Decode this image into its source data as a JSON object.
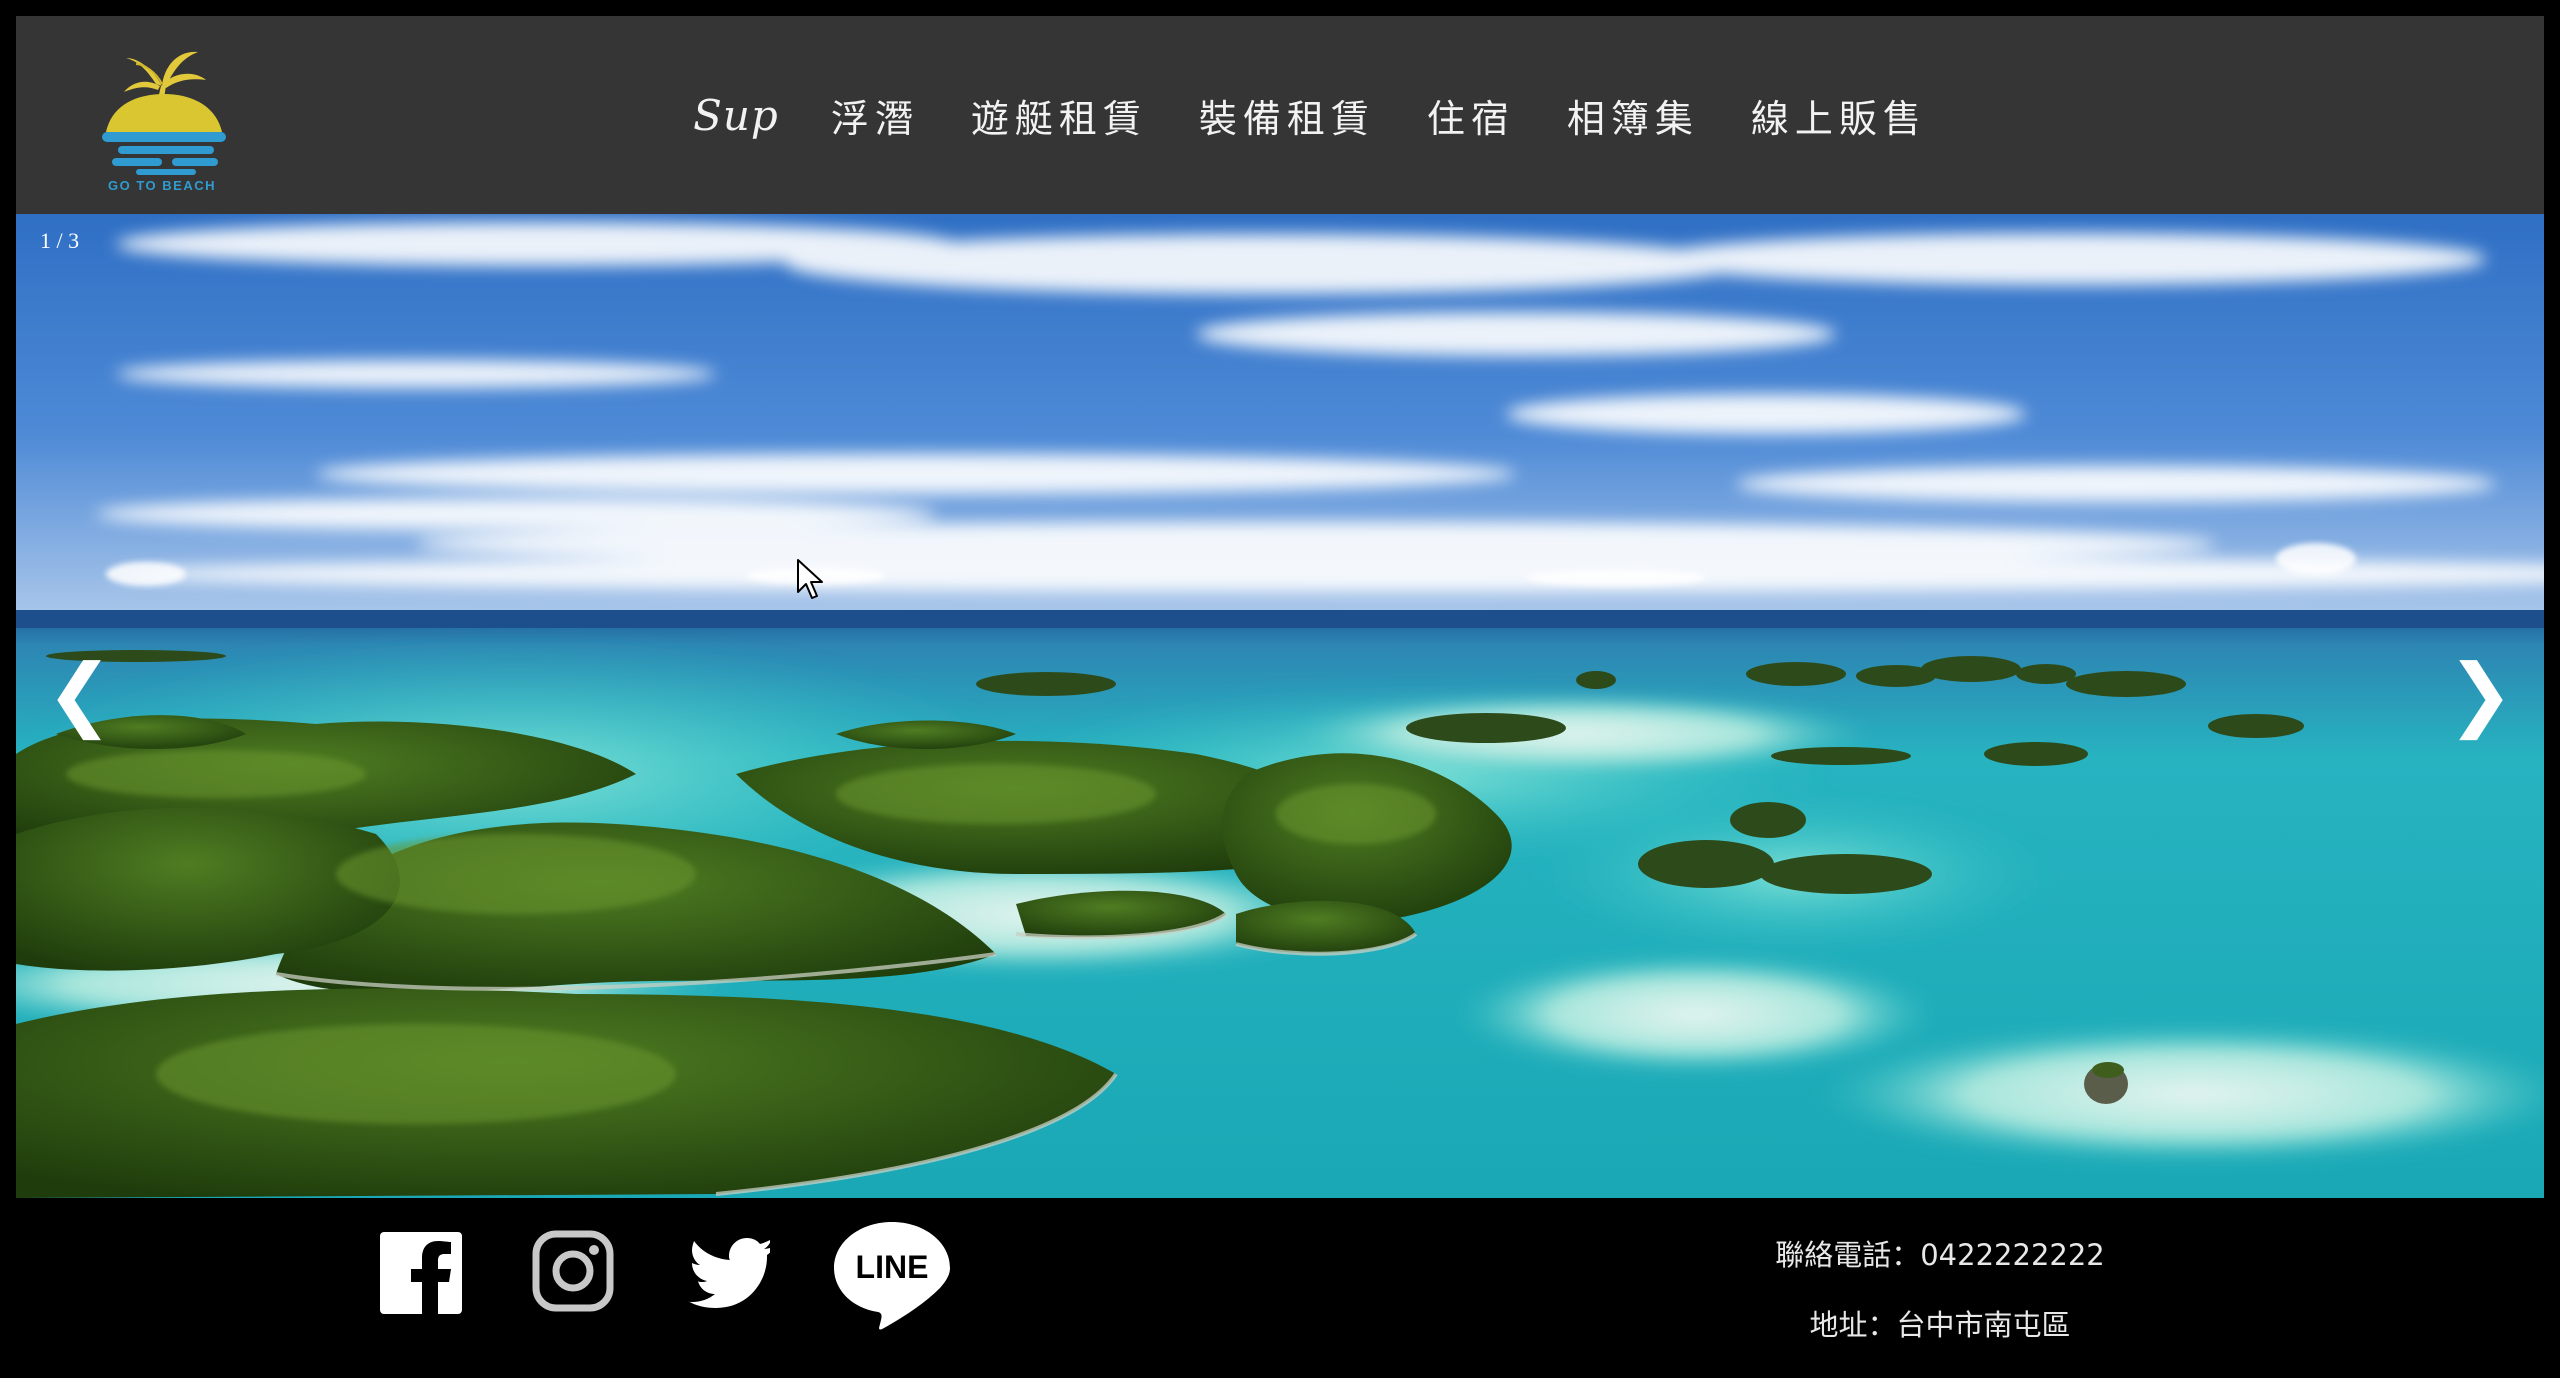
{
  "header": {
    "logo_text": "GO TO BEACH",
    "nav": [
      {
        "label": "Sup"
      },
      {
        "label": "浮潛"
      },
      {
        "label": "遊艇租賃"
      },
      {
        "label": "裝備租賃"
      },
      {
        "label": "住宿"
      },
      {
        "label": "相簿集"
      },
      {
        "label": "線上販售"
      }
    ]
  },
  "slideshow": {
    "counter": "1 / 3",
    "prev_arrow": "❮",
    "next_arrow": "❯"
  },
  "footer": {
    "social": [
      {
        "icon": "facebook-icon"
      },
      {
        "icon": "instagram-icon"
      },
      {
        "icon": "twitter-icon"
      },
      {
        "icon": "line-icon",
        "label": "LINE"
      }
    ],
    "phone": "聯絡電話：0422222222",
    "address": "地址：台中市南屯區"
  },
  "colors": {
    "header_bg": "#353535",
    "page_bg": "#000000",
    "logo_blue": "#2f9bd0",
    "logo_yellow": "#d9c631"
  }
}
